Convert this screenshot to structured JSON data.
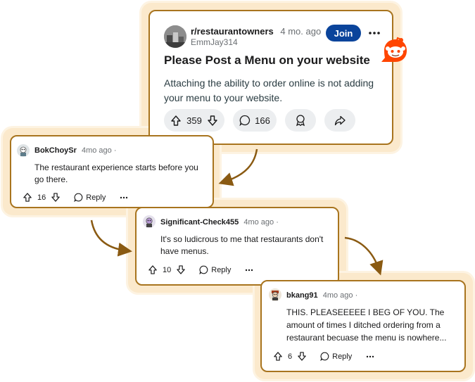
{
  "post": {
    "subreddit": "r/restaurantowners",
    "age": "4 mo. ago",
    "author": "EmmJay314",
    "join_label": "Join",
    "title": "Please Post a Menu on your website",
    "body": "Attaching the ability to order online is not adding your menu to your website.",
    "upvotes": "359",
    "comments": "166"
  },
  "comments": [
    {
      "username": "BokChoySr",
      "age": "4mo ago",
      "text": "The restaurant experience starts before you go there.",
      "votes": "16",
      "reply_label": "Reply"
    },
    {
      "username": "Significant-Check455",
      "age": "4mo ago",
      "text": "It's so ludicrous to me that restaurants don't have menus.",
      "votes": "10",
      "reply_label": "Reply"
    },
    {
      "username": "bkang91",
      "age": "4mo ago",
      "text": "THIS. PLEASEEEEE I BEG OF YOU. The amount of times I ditched ordering from a restaurant becuase the menu is nowhere...",
      "votes": "6",
      "reply_label": "Reply"
    }
  ],
  "icons": {
    "upvote": "upvote-arrow-icon",
    "downvote": "downvote-arrow-icon",
    "comment": "comment-bubble-icon",
    "award": "award-icon",
    "share": "share-icon",
    "more": "more-dots-icon",
    "logo": "reddit-logo-icon"
  },
  "colors": {
    "accent": "#0a449b",
    "border": "#a8741e",
    "reddit": "#ff4500",
    "glow": "#fbe9cc"
  }
}
